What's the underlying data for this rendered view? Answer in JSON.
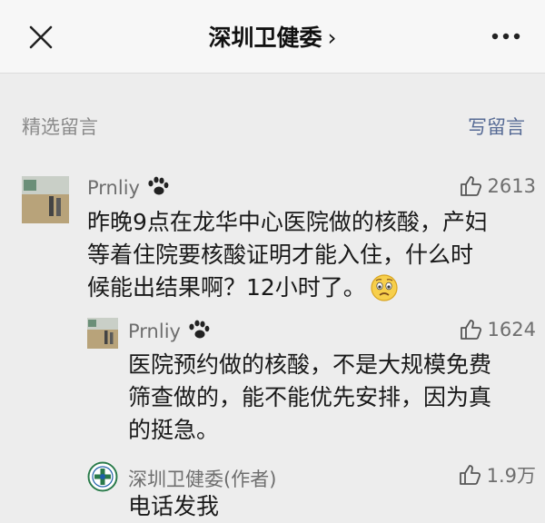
{
  "header": {
    "title": "深圳卫健委",
    "chevron": "›"
  },
  "section": {
    "label": "精选留言",
    "write_label": "写留言"
  },
  "comments": [
    {
      "user": "Prnliy",
      "likes": "2613",
      "lines": [
        "昨晚9点在龙华中心医院做的核酸，产妇",
        "等着住院要核酸证明才能入住，什么时",
        "候能出结果啊？12小时了。"
      ]
    },
    {
      "user": "Prnliy",
      "likes": "1624",
      "lines": [
        "医院预约做的核酸，不是大规模免费",
        "筛查做的，能不能优先安排，因为真",
        "的挺急。"
      ]
    },
    {
      "user": "深圳卫健委(作者)",
      "likes": "1.9万",
      "lines": [
        "电话发我"
      ]
    }
  ],
  "colors": {
    "link": "#576b95",
    "background": "#ededed",
    "text": "#191919",
    "muted": "#8a8a8a"
  },
  "icons": [
    "close-icon",
    "more-icon",
    "chevron-right-icon",
    "paw-icon",
    "thumbs-up-icon",
    "worried-face-emoji",
    "health-commission-logo"
  ]
}
